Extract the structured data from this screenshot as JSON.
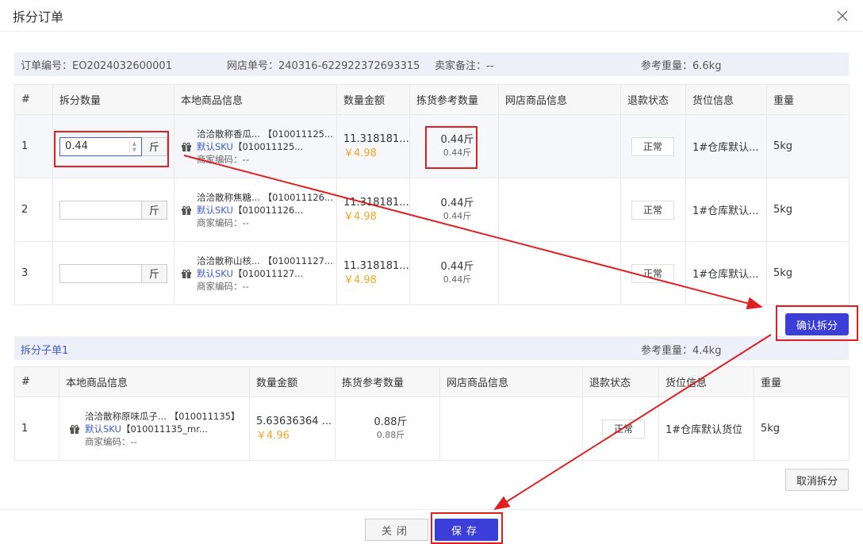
{
  "modal": {
    "title": "拆分订单"
  },
  "info": {
    "order_no": "订单编号：EO2024032600001",
    "shop_no": "网店单号：240316-622922372693315",
    "seller_note": "卖家备注：--",
    "ref_weight": "参考重量：6.6kg"
  },
  "split_table": {
    "headers": [
      "#",
      "拆分数量",
      "本地商品信息",
      "数量金额",
      "拣货参考数量",
      "网店商品信息",
      "退款状态",
      "货位信息",
      "重量"
    ],
    "rows": [
      {
        "index": "1",
        "qty": "0.44",
        "unit": "斤",
        "name": "洽洽散称香瓜...",
        "code": "【010011125...",
        "sku": "默认SKU",
        "sku_code": "【010011125...",
        "merchant": "商家编码：--",
        "amount": "11.318181...",
        "price": "￥4.98",
        "ref_qty": "0.44斤",
        "ref_sub": "0.44斤",
        "status": "正常",
        "location": "1#仓库默认...",
        "weight": "5kg"
      },
      {
        "index": "2",
        "qty": "",
        "unit": "斤",
        "name": "洽洽散称焦糖...",
        "code": "【010011126...",
        "sku": "默认SKU",
        "sku_code": "【010011126...",
        "merchant": "商家编码：--",
        "amount": "11.318181...",
        "price": "￥4.98",
        "ref_qty": "0.44斤",
        "ref_sub": "0.44斤",
        "status": "正常",
        "location": "1#仓库默认...",
        "weight": "5kg"
      },
      {
        "index": "3",
        "qty": "",
        "unit": "斤",
        "name": "洽洽散称山核...",
        "code": "【010011127...",
        "sku": "默认SKU",
        "sku_code": "【010011127...",
        "merchant": "商家编码：--",
        "amount": "11.318181...",
        "price": "￥4.98",
        "ref_qty": "0.44斤",
        "ref_sub": "0.44斤",
        "status": "正常",
        "location": "1#仓库默认...",
        "weight": "5kg"
      }
    ]
  },
  "buttons": {
    "confirm_split": "确认拆分",
    "cancel_split": "取消拆分",
    "close": "关闭",
    "save": "保存"
  },
  "sub_order": {
    "title": "拆分子单1",
    "ref_weight": "参考重量：4.4kg",
    "headers": [
      "#",
      "本地商品信息",
      "数量金额",
      "拣货参考数量",
      "网店商品信息",
      "退款状态",
      "货位信息",
      "重量"
    ],
    "rows": [
      {
        "index": "1",
        "name": "洽洽散称原味瓜子...",
        "code": "【010011135】",
        "sku": "默认SKU",
        "sku_code": "【010011135_mr...",
        "merchant": "商家编码：--",
        "amount": "5.63636364 ...",
        "price": "￥4.96",
        "ref_qty": "0.88斤",
        "ref_sub": "0.88斤",
        "status": "正常",
        "location": "1#仓库默认货位",
        "weight": "5kg"
      }
    ]
  },
  "colors": {
    "accent": "#3b3fd8",
    "annotation": "#e02020",
    "price": "#f5a623",
    "link": "#3d5ccf"
  }
}
